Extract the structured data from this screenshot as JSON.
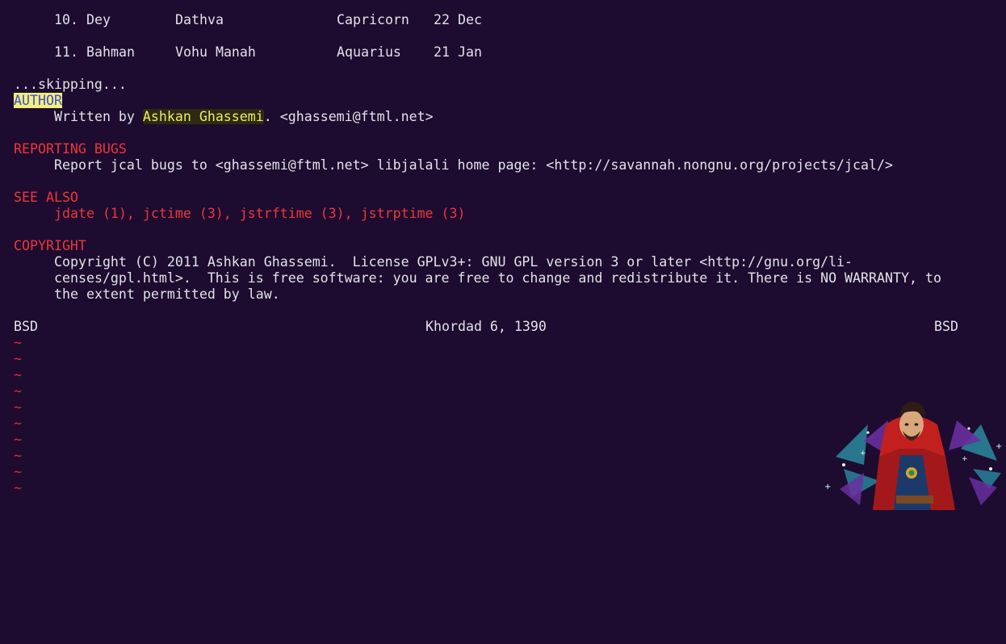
{
  "months": [
    {
      "num": "10.",
      "name": "Dey",
      "angel": "Dathva",
      "sign": "Capricorn",
      "date": "22 Dec"
    },
    {
      "num": "11.",
      "name": "Bahman",
      "angel": "Vohu Manah",
      "sign": "Aquarius",
      "date": "21 Jan"
    }
  ],
  "skipping": "...skipping...",
  "author": {
    "heading": "AUTHOR",
    "prefix": "Written by ",
    "name": "Ashkan Ghassemi",
    "suffix": ". <ghassemi@ftml.net>"
  },
  "bugs": {
    "heading": "REPORTING BUGS",
    "text": "Report jcal bugs to <ghassemi@ftml.net> libjalali home page: <http://savannah.nongnu.org/projects/jcal/>"
  },
  "see_also": {
    "heading": "SEE ALSO",
    "text": "jdate (1), jctime (3), jstrftime (3), jstrptime (3)"
  },
  "copyright": {
    "heading": "COPYRIGHT",
    "line1": "Copyright (C) 2011 Ashkan Ghassemi.  License GPLv3+: GNU GPL version 3 or later <http://gnu.org/li-",
    "line2": "censes/gpl.html>.  This is free software: you are free to change and redistribute it. There is NO WARRANTY, to",
    "line3": "the extent permitted by law."
  },
  "footer": {
    "left": "BSD",
    "center": "Khordad 6, 1390",
    "right": "BSD"
  },
  "tildes": [
    "~",
    "~",
    "~",
    "~",
    "~",
    "~",
    "~",
    "~",
    "~",
    "~"
  ],
  "colors": {
    "background": "#1d0c2f",
    "text": "#e3e1ea",
    "heading_red": "#f0353b",
    "highlight_yellow": "#f3ef7c",
    "name_yellow": "#f0eb60"
  },
  "mascot_icon": "doctor-strange-character-icon"
}
